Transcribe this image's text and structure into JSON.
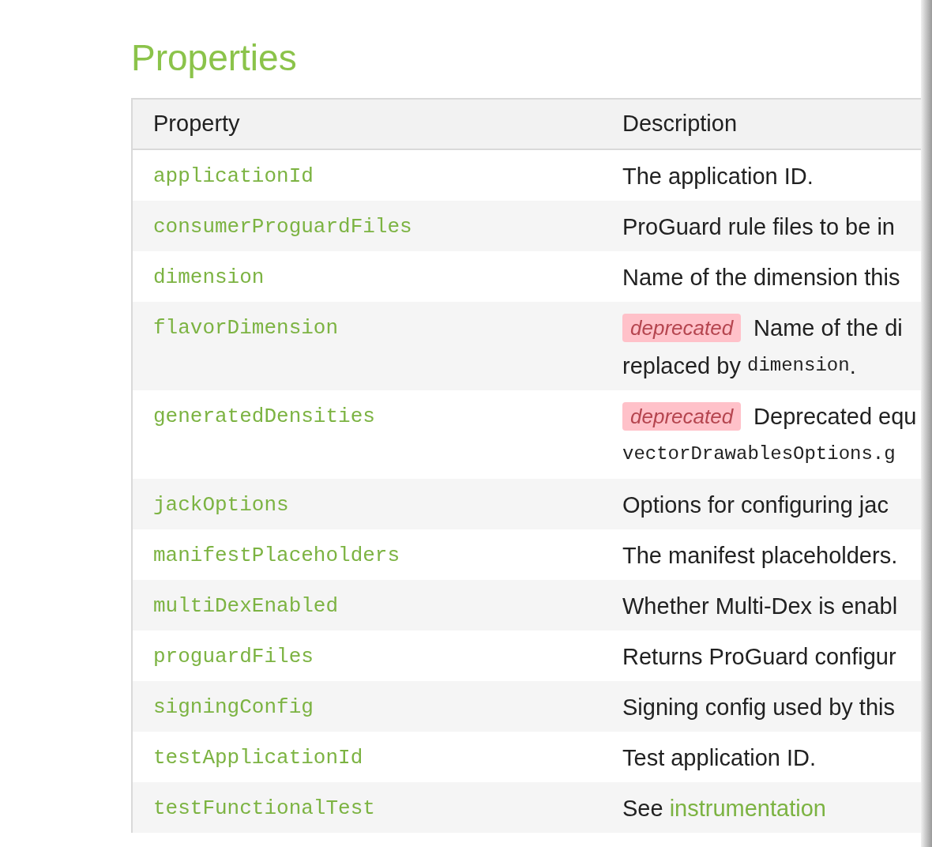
{
  "heading": "Properties",
  "table": {
    "columns": [
      "Property",
      "Description"
    ],
    "rows": [
      {
        "property": "applicationId",
        "badge": null,
        "description": [
          {
            "kind": "text",
            "text": "The application ID."
          }
        ]
      },
      {
        "property": "consumerProguardFiles",
        "badge": null,
        "description": [
          {
            "kind": "text",
            "text": "ProGuard rule files to be in"
          }
        ]
      },
      {
        "property": "dimension",
        "badge": null,
        "description": [
          {
            "kind": "text",
            "text": "Name of the dimension this"
          }
        ]
      },
      {
        "property": "flavorDimension",
        "badge": "deprecated",
        "description": [
          {
            "kind": "text",
            "text": "Name of the di"
          },
          {
            "kind": "break"
          },
          {
            "kind": "text",
            "text": "replaced by "
          },
          {
            "kind": "code",
            "text": "dimension"
          },
          {
            "kind": "text",
            "text": "."
          }
        ]
      },
      {
        "property": "generatedDensities",
        "badge": "deprecated",
        "description": [
          {
            "kind": "text",
            "text": "Deprecated equ"
          },
          {
            "kind": "break"
          },
          {
            "kind": "code",
            "text": "vectorDrawablesOptions.g"
          }
        ]
      },
      {
        "property": "jackOptions",
        "badge": null,
        "description": [
          {
            "kind": "text",
            "text": "Options for configuring jac"
          }
        ]
      },
      {
        "property": "manifestPlaceholders",
        "badge": null,
        "description": [
          {
            "kind": "text",
            "text": "The manifest placeholders."
          }
        ]
      },
      {
        "property": "multiDexEnabled",
        "badge": null,
        "description": [
          {
            "kind": "text",
            "text": "Whether Multi-Dex is enabl"
          }
        ]
      },
      {
        "property": "proguardFiles",
        "badge": null,
        "description": [
          {
            "kind": "text",
            "text": "Returns ProGuard configur"
          }
        ]
      },
      {
        "property": "signingConfig",
        "badge": null,
        "description": [
          {
            "kind": "text",
            "text": "Signing config used by this"
          }
        ]
      },
      {
        "property": "testApplicationId",
        "badge": null,
        "description": [
          {
            "kind": "text",
            "text": "Test application ID."
          }
        ]
      },
      {
        "property": "testFunctionalTest",
        "badge": null,
        "description": [
          {
            "kind": "text",
            "text": "See "
          },
          {
            "kind": "link",
            "text": "instrumentation"
          }
        ]
      }
    ]
  }
}
